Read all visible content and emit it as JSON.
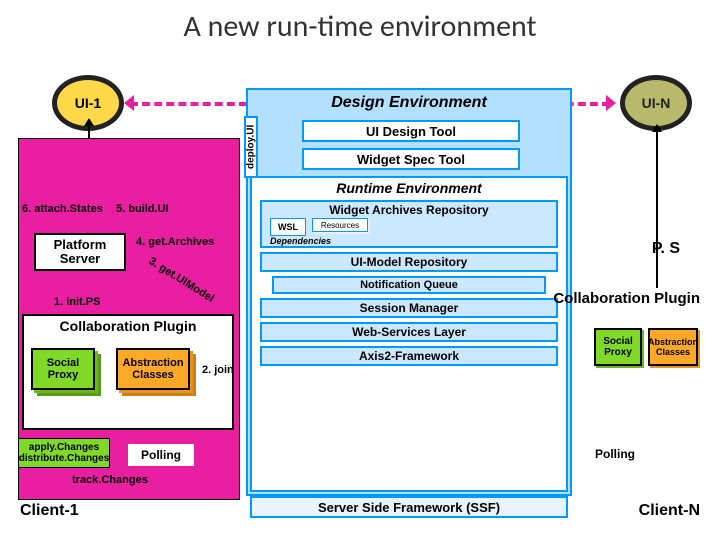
{
  "title": "A new run-time environment",
  "ui1_label": "UI-1",
  "uin_label": "UI-N",
  "client1_label": "Client-1",
  "clientN_label": "Client-N",
  "attach_states": "6. attach.States",
  "build_ui": "5. build.UI",
  "platform_server": "Platform Server",
  "get_archives": "4. get.Archives",
  "init_ps": "1. init.PS",
  "get_uimodel": "3. get.UIModel",
  "collab_plugin": "Collaboration Plugin",
  "social_proxy": "Social Proxy",
  "abstraction_classes": "Abstraction Classes",
  "join": "2. join",
  "apply_distribute": "apply.Changes distribute.Changes",
  "polling": "Polling",
  "track_changes": "track.Changes",
  "design_env": "Design Environment",
  "ui_design_tool": "UI Design Tool",
  "widget_spec_tool": "Widget Spec Tool",
  "deploy_ui": "deploy.UI",
  "runtime_env": "Runtime Environment",
  "widget_archives": "Widget Archives Repository",
  "wsl": "WSL",
  "resources": "Resources",
  "dependencies": "Dependencies",
  "uimodel_repo": "UI-Model Repository",
  "notification_queue": "Notification Queue",
  "session_manager": "Session Manager",
  "web_services": "Web-Services Layer",
  "axis2": "Axis2-Framework",
  "ssf": "Server Side Framework (SSF)",
  "ps_short": "P. S"
}
